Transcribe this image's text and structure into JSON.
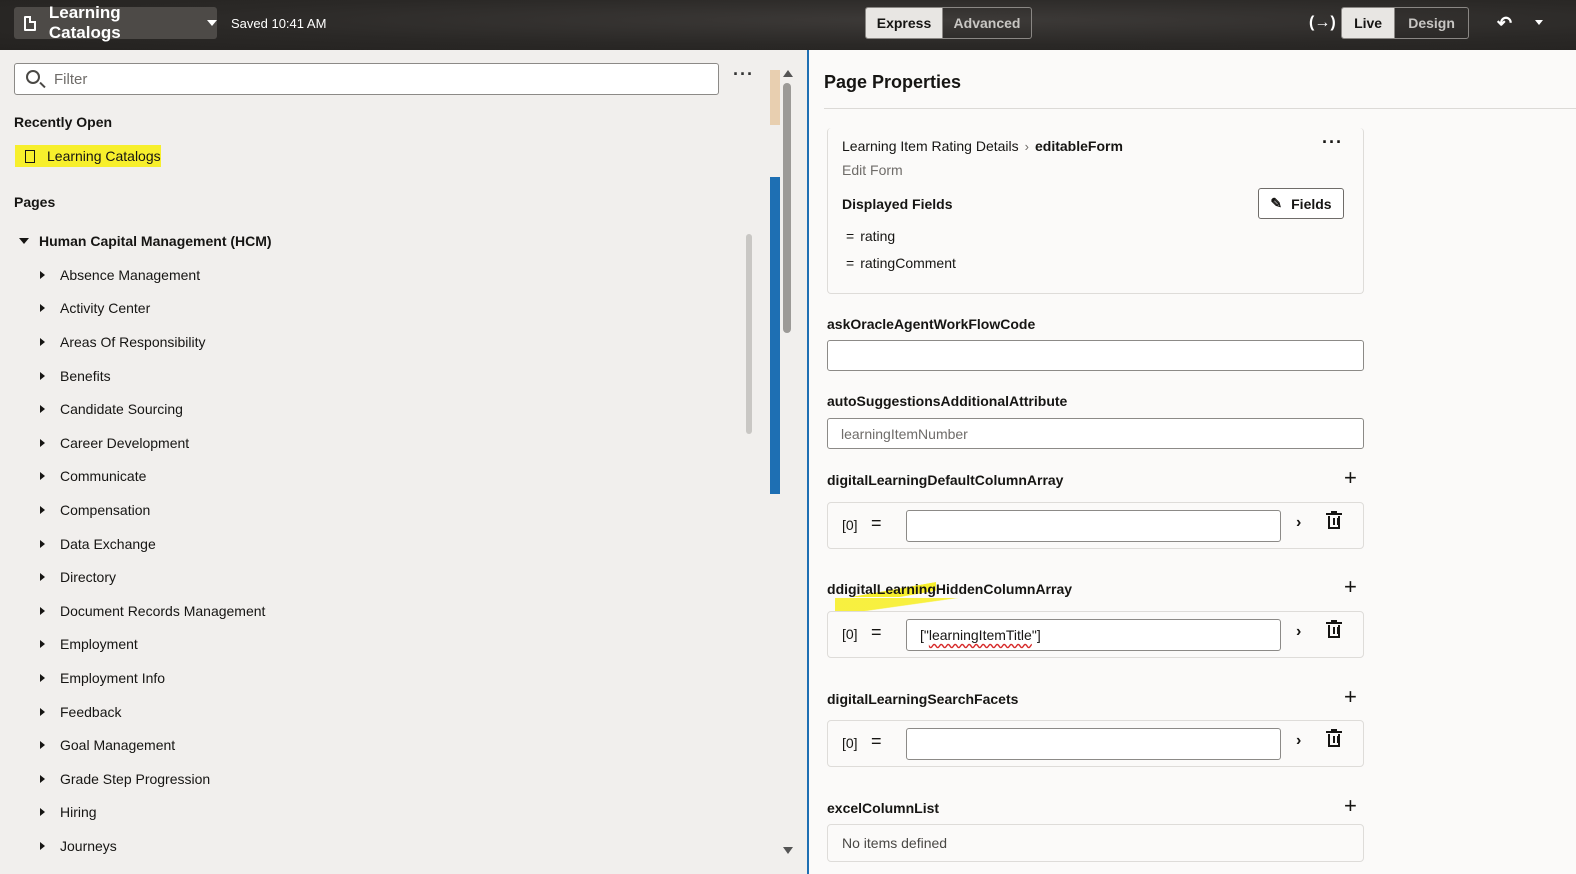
{
  "header": {
    "app_title": "Learning Catalogs",
    "saved_status": "Saved 10:41 AM",
    "mode_tabs": [
      "Express",
      "Advanced"
    ],
    "view_tabs": [
      "Live",
      "Design"
    ],
    "expression_icon": "(→)",
    "undo_icon": "↶"
  },
  "left": {
    "filter_placeholder": "Filter",
    "recently_open_title": "Recently Open",
    "recent_item": "Learning Catalogs",
    "pages_title": "Pages",
    "tree_root": "Human Capital Management (HCM)",
    "tree_items": [
      "Absence Management",
      "Activity Center",
      "Areas Of Responsibility",
      "Benefits",
      "Candidate Sourcing",
      "Career Development",
      "Communicate",
      "Compensation",
      "Data Exchange",
      "Directory",
      "Document Records Management",
      "Employment",
      "Employment Info",
      "Feedback",
      "Goal Management",
      "Grade Step Progression",
      "Hiring",
      "Journeys"
    ]
  },
  "right": {
    "title": "Page Properties",
    "breadcrumb_parent": "Learning Item Rating Details",
    "breadcrumb_current": "editableForm",
    "subtitle": "Edit Form",
    "displayed_fields_label": "Displayed Fields",
    "fields_button": "Fields",
    "displayed_fields": [
      "rating",
      "ratingComment"
    ],
    "properties": {
      "ask_oracle_label": "askOracleAgentWorkFlowCode",
      "ask_oracle_value": "",
      "auto_suggest_label": "autoSuggestionsAdditionalAttribute",
      "auto_suggest_value": "learningItemNumber",
      "default_column_label": "digitalLearningDefaultColumnArray",
      "default_column_index": "[0]",
      "default_column_value": "",
      "hidden_column_label_hl": "digitalLearning",
      "hidden_column_label_first": "d",
      "hidden_column_label_rest": "HiddenColumnArray",
      "hidden_column_index": "[0]",
      "hidden_column_value_q1": "[\"",
      "hidden_column_value_word": "learningItemTitle",
      "hidden_column_value_q2": "\"]",
      "search_facets_label": "digitalLearningSearchFacets",
      "search_facets_index": "[0]",
      "search_facets_value": "",
      "excel_label": "excelColumnList",
      "excel_empty": "No items defined"
    }
  }
}
